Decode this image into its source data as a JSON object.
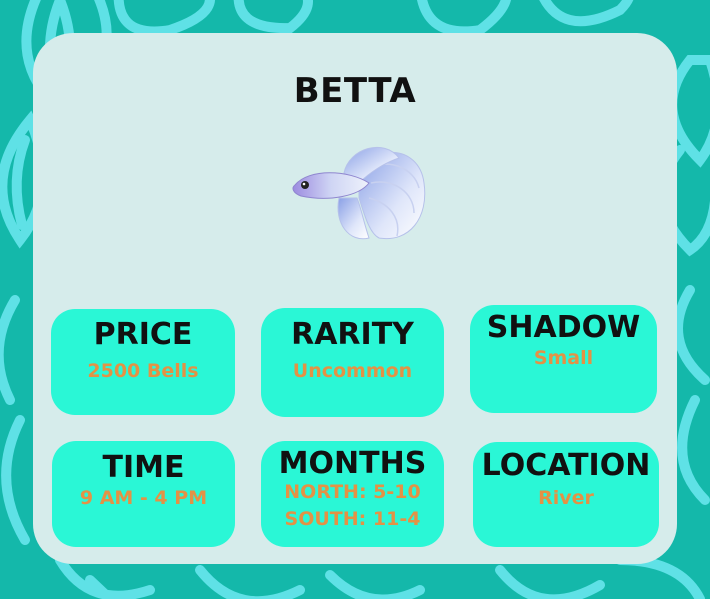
{
  "title": "BETTA",
  "fish_icon": "betta-fish-icon",
  "colors": {
    "background": "#14b8aa",
    "background_pattern": "#5fe1e6",
    "card": "#d6eceb",
    "tile": "#2af7d6",
    "label": "#111111",
    "value": "#e39245"
  },
  "tiles": {
    "price": {
      "label": "PRICE",
      "value": "2500 Bells"
    },
    "rarity": {
      "label": "RARITY",
      "value": "Uncommon"
    },
    "shadow": {
      "label": "SHADOW",
      "value": "Small"
    },
    "time": {
      "label": "TIME",
      "value": "9 AM - 4 PM"
    },
    "months": {
      "label": "MONTHS",
      "north": "NORTH: 5-10",
      "south": "SOUTH: 11-4"
    },
    "location": {
      "label": "LOCATION",
      "value": "River"
    }
  }
}
